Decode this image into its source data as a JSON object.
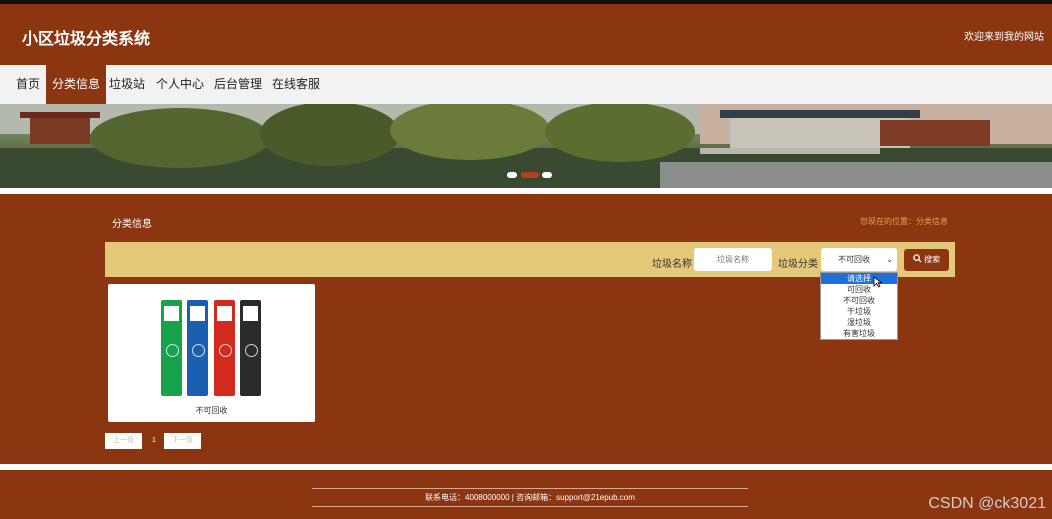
{
  "header": {
    "site_title": "小区垃圾分类系统",
    "welcome": "欢迎来到我的网站"
  },
  "nav": {
    "items": [
      "首页",
      "分类信息",
      "垃圾站",
      "个人中心",
      "后台管理",
      "在线客服"
    ],
    "active_index": 1
  },
  "section": {
    "title": "分类信息",
    "location": "您现在的位置：分类信息"
  },
  "search": {
    "name_label": "垃圾名称",
    "name_placeholder": "垃圾名称",
    "category_label": "垃圾分类",
    "category_value": "不可回收",
    "button_label": "搜索",
    "dropdown_options": [
      "请选择",
      "可回收",
      "不可回收",
      "干垃圾",
      "湿垃圾",
      "有害垃圾"
    ],
    "dropdown_highlighted": 0
  },
  "items": [
    {
      "label": "不可回收"
    }
  ],
  "pager": {
    "prev": "上一页",
    "page": "1",
    "next": "下一页"
  },
  "footer": {
    "text": "联系电话：4008000000 | 咨询邮箱：support@21epub.com"
  },
  "watermark": "CSDN @ck3021",
  "colors": {
    "brand": "#8b3511",
    "search_bar": "#e4c97a",
    "location_text": "#e2a24f",
    "dropdown_highlight": "#1e6fd9"
  }
}
